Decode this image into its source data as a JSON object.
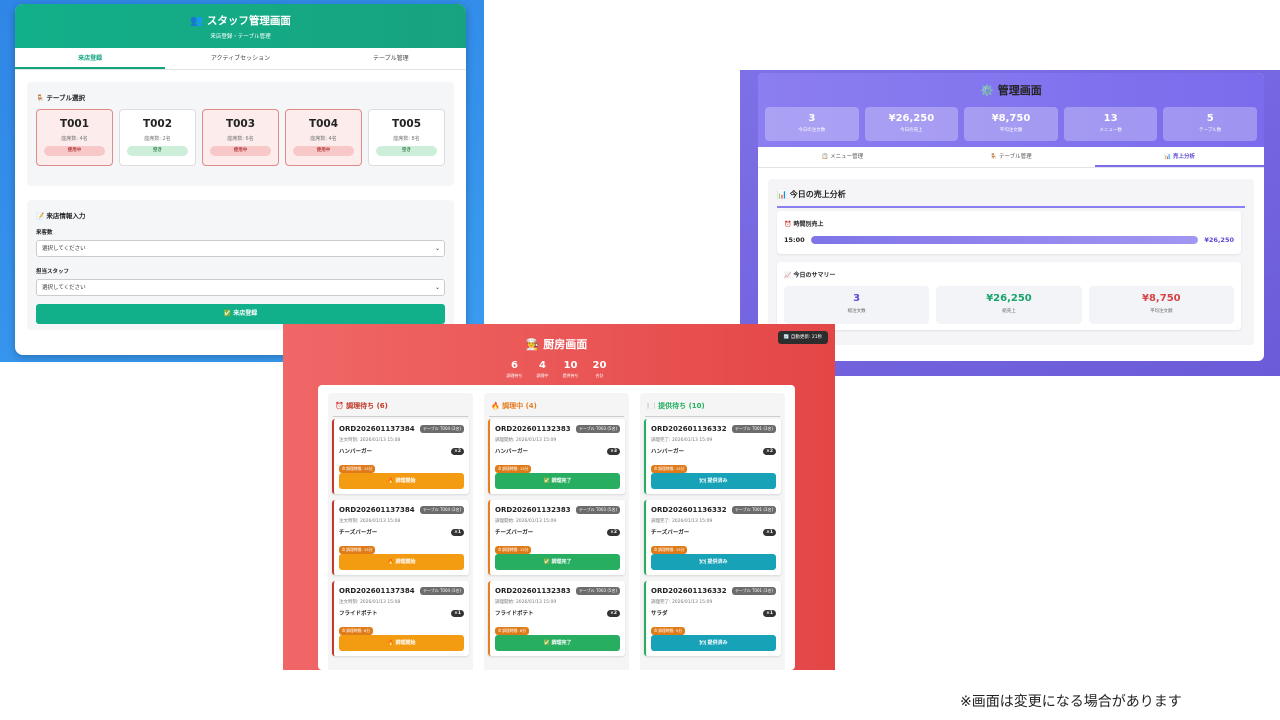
{
  "staff": {
    "title": "👥 スタッフ管理画面",
    "subtitle": "来店登録・テーブル管理",
    "tabs": [
      "来店登録",
      "アクティブセッション",
      "テーブル管理"
    ],
    "table_section_title": "🪑 テーブル選択",
    "tables": [
      {
        "id": "T001",
        "seats": "座席数: 4名",
        "status": "使用中",
        "state": "busy"
      },
      {
        "id": "T002",
        "seats": "座席数: 2名",
        "status": "空き",
        "state": "free"
      },
      {
        "id": "T003",
        "seats": "座席数: 6名",
        "status": "使用中",
        "state": "busy"
      },
      {
        "id": "T004",
        "seats": "座席数: 4名",
        "status": "使用中",
        "state": "busy"
      },
      {
        "id": "T005",
        "seats": "座席数: 8名",
        "status": "空き",
        "state": "free"
      }
    ],
    "form_title": "📝 来店情報入力",
    "guests_label": "来客数",
    "guests_value": "選択してください",
    "staff_label": "担当スタッフ",
    "staff_value": "選択してください",
    "register_button": "✅ 来店登録"
  },
  "admin": {
    "title": "⚙️ 管理画面",
    "stats": [
      {
        "value": "3",
        "label": "今日の注文数"
      },
      {
        "value": "¥26,250",
        "label": "今日の売上"
      },
      {
        "value": "¥8,750",
        "label": "平均注文額"
      },
      {
        "value": "13",
        "label": "メニュー数"
      },
      {
        "value": "5",
        "label": "テーブル数"
      }
    ],
    "tabs": [
      "📋 メニュー管理",
      "🪑 テーブル管理",
      "📊 売上分析"
    ],
    "analysis_title": "📊 今日の売上分析",
    "hourly_title": "⏰ 時間別売上",
    "hourly": {
      "label": "15:00",
      "value": "¥26,250",
      "fraction": 1.0
    },
    "summary_title": "📈 今日のサマリー",
    "summary": [
      {
        "value": "3",
        "label": "総注文数",
        "color": "#5b48d6"
      },
      {
        "value": "¥26,250",
        "label": "総売上",
        "color": "#1aa36b"
      },
      {
        "value": "¥8,750",
        "label": "平均注文額",
        "color": "#d64545"
      }
    ]
  },
  "kitchen": {
    "title": "👨‍🍳 厨房画面",
    "auto_refresh": "🔄 自動更新: 21秒",
    "stats": [
      {
        "value": "6",
        "label": "調理待ち"
      },
      {
        "value": "4",
        "label": "調理中"
      },
      {
        "value": "10",
        "label": "提供待ち"
      },
      {
        "value": "20",
        "label": "合計"
      }
    ],
    "columns": [
      {
        "title": "⏰ 調理待ち (6)",
        "color": "#c0392b",
        "btn_color": "#f39c12",
        "orders": [
          {
            "id": "ORD202601137384",
            "table": "テーブル T004 (3名)",
            "time": "注文時刻: 2026/01/13 15:08",
            "item": "ハンバーガー",
            "qty": "×2",
            "elapsed": "⏱ 調理時間: 15分",
            "action": "🔥 調理開始"
          },
          {
            "id": "ORD202601137384",
            "table": "テーブル T004 (3名)",
            "time": "注文時刻: 2026/01/13 15:08",
            "item": "チーズバーガー",
            "qty": "×1",
            "elapsed": "⏱ 調理時間: 15分",
            "action": "🔥 調理開始"
          },
          {
            "id": "ORD202601137384",
            "table": "テーブル T004 (3名)",
            "time": "注文時刻: 2026/01/13 15:08",
            "item": "フライドポテト",
            "qty": "×1",
            "elapsed": "⏱ 調理時間: 8分",
            "action": "🔥 調理開始"
          }
        ]
      },
      {
        "title": "🔥 調理中 (4)",
        "color": "#e67e22",
        "btn_color": "#27ae60",
        "orders": [
          {
            "id": "ORD202601132383",
            "table": "テーブル T003 (5名)",
            "time": "調理開始: 2026/01/13 15:09",
            "item": "ハンバーガー",
            "qty": "×3",
            "elapsed": "⏱ 調理時間: 15分",
            "action": "✅ 調理完了"
          },
          {
            "id": "ORD202601132383",
            "table": "テーブル T003 (5名)",
            "time": "調理開始: 2026/01/13 15:09",
            "item": "チーズバーガー",
            "qty": "×2",
            "elapsed": "⏱ 調理時間: 15分",
            "action": "✅ 調理完了"
          },
          {
            "id": "ORD202601132383",
            "table": "テーブル T003 (5名)",
            "time": "調理開始: 2026/01/13 15:09",
            "item": "フライドポテト",
            "qty": "×2",
            "elapsed": "⏱ 調理時間: 8分",
            "action": "✅ 調理完了"
          }
        ]
      },
      {
        "title": "🍽️ 提供待ち (10)",
        "color": "#27ae60",
        "btn_color": "#17a2b8",
        "orders": [
          {
            "id": "ORD202601136332",
            "table": "テーブル T001 (3名)",
            "time": "調理完了: 2026/01/13 15:09",
            "item": "ハンバーガー",
            "qty": "×2",
            "elapsed": "⏱ 調理時間: 15分",
            "action": "🍽 提供済み"
          },
          {
            "id": "ORD202601136332",
            "table": "テーブル T001 (3名)",
            "time": "調理完了: 2026/01/13 15:09",
            "item": "チーズバーガー",
            "qty": "×1",
            "elapsed": "⏱ 調理時間: 15分",
            "action": "🍽 提供済み"
          },
          {
            "id": "ORD202601136332",
            "table": "テーブル T001 (3名)",
            "time": "調理完了: 2026/01/13 15:09",
            "item": "サラダ",
            "qty": "×1",
            "elapsed": "⏱ 調理時間: 5分",
            "action": "🍽 提供済み"
          }
        ]
      }
    ]
  },
  "footnote": "※画面は変更になる場合があります"
}
